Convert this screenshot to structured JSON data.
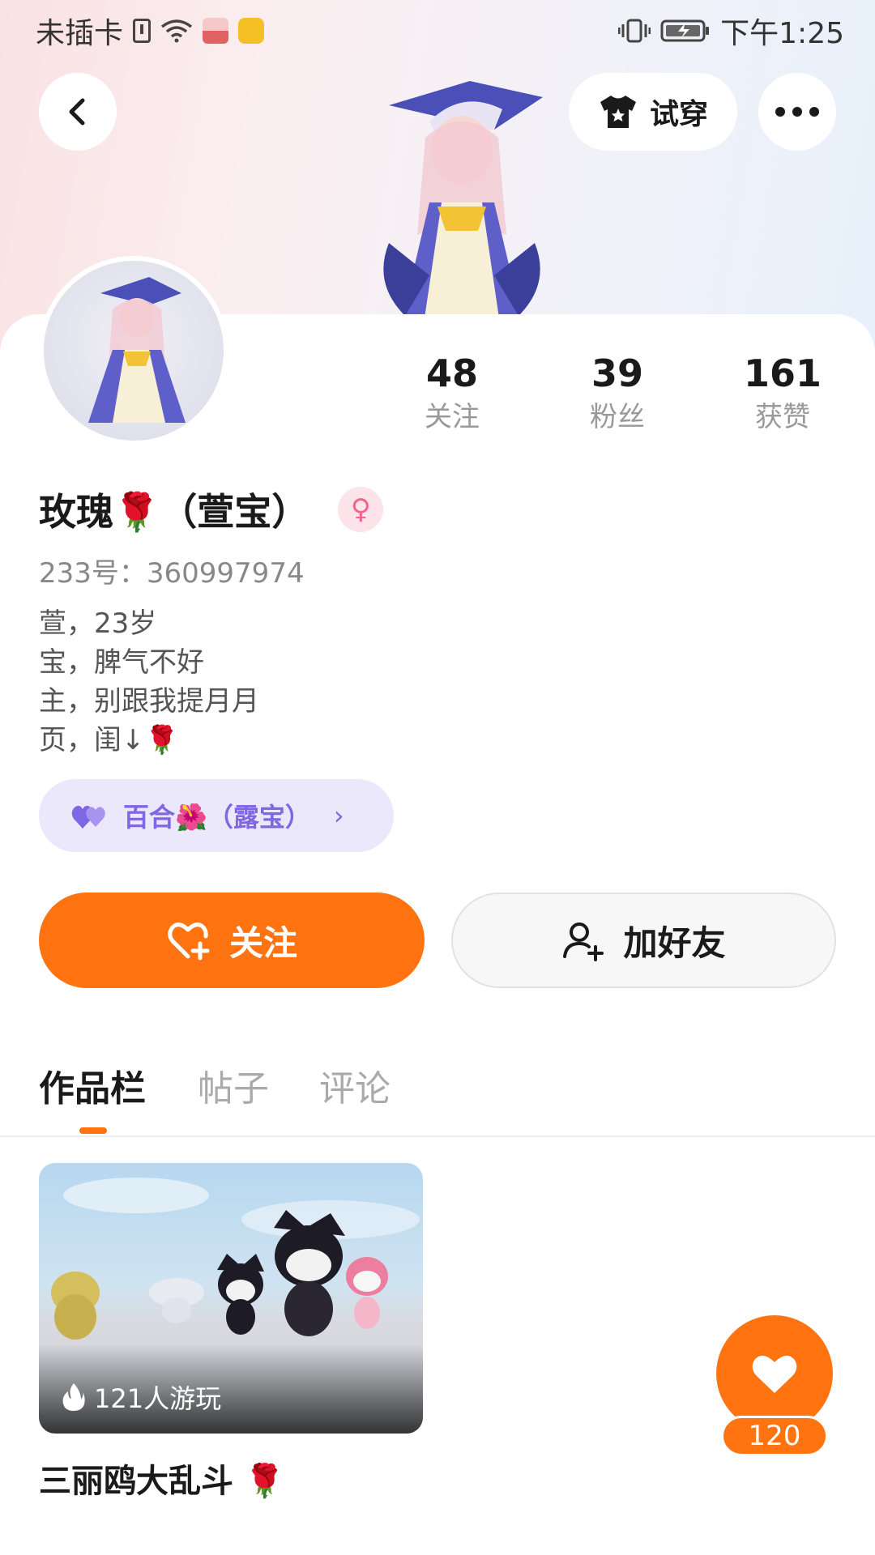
{
  "status_bar": {
    "carrier": "未插卡",
    "time": "下午1:25"
  },
  "header": {
    "tryon_label": "试穿"
  },
  "profile": {
    "name": "玫瑰🌹（萱宝）",
    "gender_symbol": "♀",
    "uid": "233号：360997974",
    "bio": [
      "萱，23岁",
      "宝，脾气不好",
      "主，别跟我提月月",
      "页，闺↓🌹"
    ],
    "relation_label": "百合🌺（露宝）",
    "relation_chevron": "›"
  },
  "stats": {
    "following": {
      "value": "48",
      "label": "关注"
    },
    "followers": {
      "value": "39",
      "label": "粉丝"
    },
    "likes": {
      "value": "161",
      "label": "获赞"
    }
  },
  "actions": {
    "follow_label": "关注",
    "add_friend_label": "加好友"
  },
  "tabs": [
    "作品栏",
    "帖子",
    "评论"
  ],
  "works": [
    {
      "title": "三丽鸥大乱斗 🌹",
      "plays": "121人游玩"
    }
  ],
  "like_fab": {
    "count": "120"
  },
  "colors": {
    "accent": "#ff7411",
    "relation_bg": "#ebe8fb",
    "relation_text": "#7d67e2",
    "gender_bg": "#fde3ea"
  }
}
